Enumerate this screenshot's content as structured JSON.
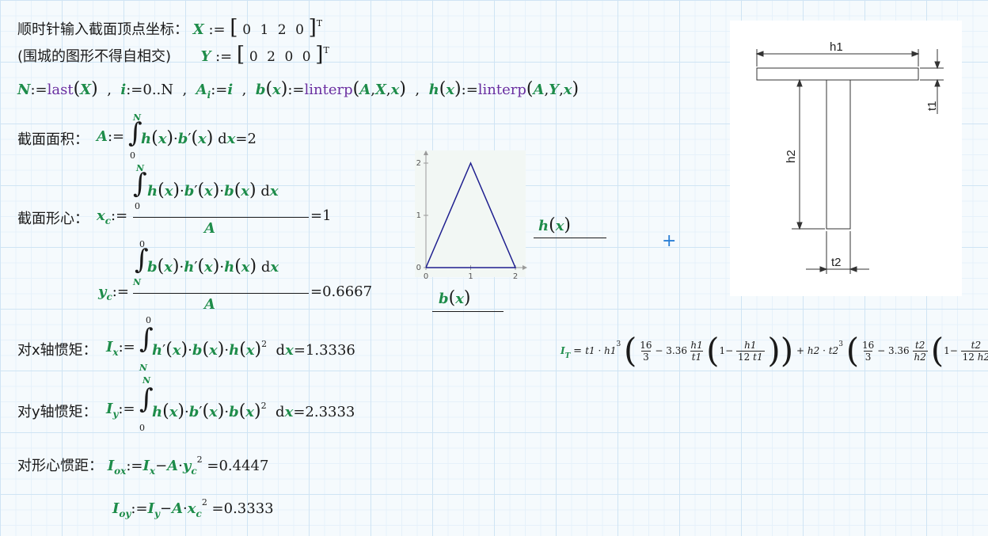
{
  "labels": {
    "vertex_input": "顺时针输入截面顶点坐标：",
    "no_self_intersect": "(围城的图形不得自相交)",
    "area": "截面面积：",
    "centroid": "截面形心：",
    "ix_label": "对x轴惯矩：",
    "iy_label": "对y轴惯矩：",
    "centroid_moment": "对形心惯距："
  },
  "vars": {
    "X": "X",
    "Y": "Y",
    "N": "N",
    "i": "i",
    "A": "A",
    "b": "b",
    "h": "h",
    "x": "x",
    "xc": "x",
    "xc_sub": "c",
    "yc": "y",
    "yc_sub": "c",
    "Ix": "I",
    "Ix_sub": "x",
    "Iy": "I",
    "Iy_sub": "y",
    "Iox": "I",
    "Iox_sub": "ox",
    "Ioy": "I",
    "Ioy_sub": "oy"
  },
  "functions": {
    "last": "last",
    "linterp": "linterp"
  },
  "matrices": {
    "X": [
      "0",
      "1",
      "2",
      "0"
    ],
    "Y": [
      "0",
      "2",
      "0",
      "0"
    ],
    "transpose": "T"
  },
  "results": {
    "area": "2",
    "xc": "1",
    "yc": "0.6667",
    "ix": "1.3336",
    "iy": "2.3333",
    "iox": "0.4447",
    "ioy": "0.3333"
  },
  "integral_limits": {
    "lower0": "0",
    "upperN": "N"
  },
  "range": "0..N",
  "plot": {
    "x_ticks": [
      "0",
      "1",
      "2"
    ],
    "y_ticks": [
      "0",
      "1",
      "2"
    ],
    "x_axis_label": "b(x)",
    "y_axis_label": "h(x)",
    "trace_color": "#1f1f8f",
    "chart_data": {
      "type": "line",
      "x": [
        0,
        1,
        2,
        0
      ],
      "y": [
        0,
        2,
        0,
        0
      ],
      "xlim": [
        0,
        2
      ],
      "ylim": [
        0,
        2
      ]
    }
  },
  "tsection": {
    "h1": "h1",
    "h2": "h2",
    "t1": "t1",
    "t2": "t2"
  },
  "it_formula": {
    "lhs": "I",
    "lhs_sub": "T",
    "c16": "16",
    "c3": "3",
    "c336": "3.36",
    "c12": "12",
    "c1": "1"
  }
}
